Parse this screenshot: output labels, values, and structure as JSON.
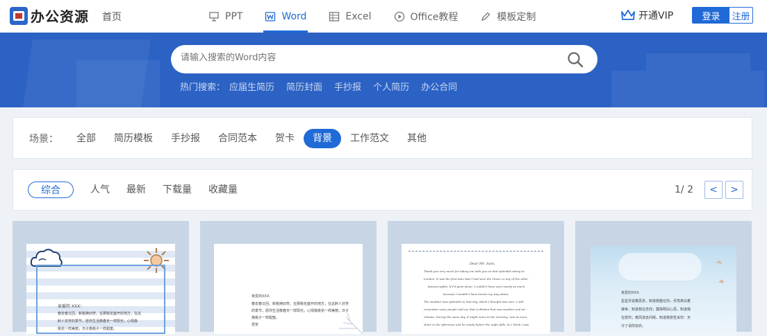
{
  "header": {
    "logo_text": "办公资源",
    "home": "首页",
    "nav": [
      {
        "label": "PPT",
        "icon": "presentation-icon"
      },
      {
        "label": "Word",
        "icon": "word-icon",
        "active": true
      },
      {
        "label": "Excel",
        "icon": "table-icon"
      },
      {
        "label": "Office教程",
        "icon": "play-circle-icon"
      },
      {
        "label": "模板定制",
        "icon": "pen-icon"
      }
    ],
    "vip": "开通VIP",
    "login": "登录",
    "register": "注册"
  },
  "search": {
    "placeholder": "请输入搜索的Word内容",
    "hot_label": "热门搜索：",
    "hot_items": [
      "应届生简历",
      "简历封面",
      "手抄报",
      "个人简历",
      "办公合同"
    ]
  },
  "scene": {
    "label": "场景：",
    "items": [
      "全部",
      "简历模板",
      "手抄报",
      "合同范本",
      "贺卡",
      "背景",
      "工作范文",
      "其他"
    ],
    "active": "背景"
  },
  "sort": {
    "items": [
      "综合",
      "人气",
      "最新",
      "下载量",
      "收藏量"
    ],
    "active": "综合",
    "page": "1/ 2",
    "prev": "<",
    "next": ">"
  },
  "cards": [
    {
      "greeting": "亲爱的 XXX：",
      "lines": [
        "春去春又回，新桃换旧符。在那桃花盛开的地方，在这",
        "醉人芬芳的季节，愿你生活像春天一样阳光，心情像",
        "桃花一样美丽，日子像桃子一样甜蜜。"
      ]
    },
    {
      "greeting": "亲爱的XXX:",
      "lines": [
        "春去春又回，新桃换旧符。在那桃花盛开的地方，在这醉人芬芳",
        "的季节，愿你生活像春天一样阳光，心情像桃花一样美丽，日子",
        "像桃子一样甜蜜。",
        "祝安"
      ]
    },
    {
      "greeting": "Dear Mr. Sam,",
      "lines": [
        "Thank you very much for taking me with you on that splendid outing to",
        "London. It was the first time that I had seen the Tower or any of the other",
        "famous sights. If I'd gone alone, I couldn't have seen nearly as much,",
        "because I wouldn't have known my way about.",
        "The weather was splendid on that day, which I thought was rare. I still",
        "remember some people told me that in Britain that was weather and air",
        "climate. During the same day, it might snow in the morning, rain at noon,",
        "shine in the afternoon and be windy before the night falls. So I think I was"
      ]
    },
    {
      "greeting": "亲爱的XXX:",
      "lines": [
        "星星并说着思念，知道我整在你，月亮表白着",
        "接幸，知道我在念你；露珠明白心思，知道我",
        "在想你；微风流去问候，知道我想告诉你：天",
        "冷了请你加衣。"
      ]
    }
  ]
}
